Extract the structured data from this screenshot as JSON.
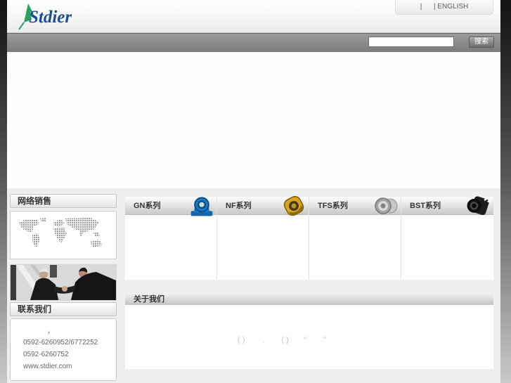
{
  "page": {
    "background_top": "#141414",
    "background_bottom": "#c9c9c9",
    "content_background": "#efefef"
  },
  "header": {
    "logo_text": "Stdier",
    "logo_color": "#1d4e91",
    "logo_icon_color": "#27a164",
    "language_switcher": "|      | ENGLISH"
  },
  "navbar": {
    "search_value": "",
    "search_button_label": "搜索"
  },
  "sidebar": {
    "sales_header": "网络销售",
    "map_icon": "dotted-world-map",
    "photo_icon": "businessmen-handshake-photo",
    "contact_header": "联系我们",
    "contact": {
      "note": "，",
      "phone_line1": "0592-6260952/6772252",
      "phone_line2": "0592-6260752",
      "website": "www.stdier.com"
    }
  },
  "products": {
    "series": [
      {
        "label": "GN系列",
        "icon": "blue-pillow-block-bearing-icon"
      },
      {
        "label": "NF系列",
        "icon": "yellow-flange-bearing-icon"
      },
      {
        "label": "TFS系列",
        "icon": "steel-bearing-icon"
      },
      {
        "label": "BST系列",
        "icon": "black-roller-bearing-icon"
      }
    ]
  },
  "about": {
    "header": "关于我们",
    "body_text": "( )        ,        ( )       “        ”"
  }
}
